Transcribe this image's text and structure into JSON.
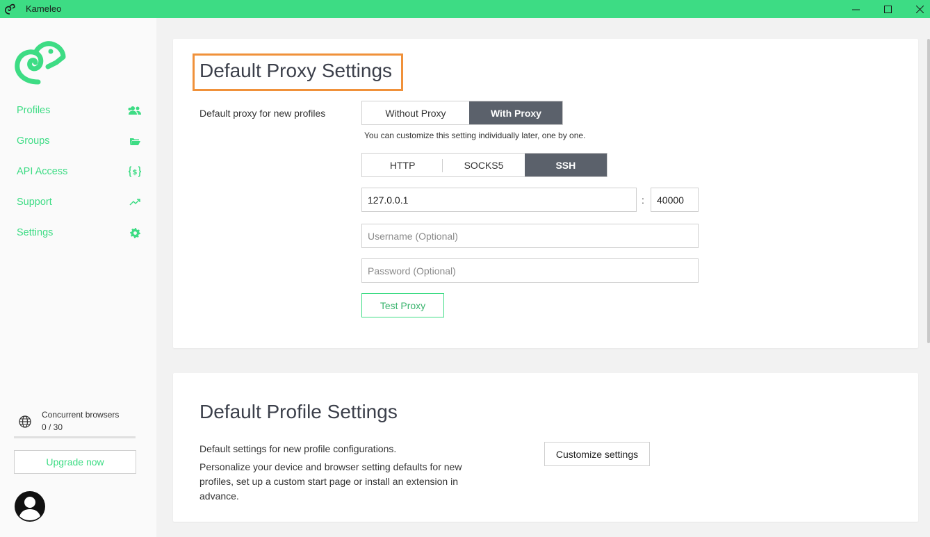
{
  "window": {
    "title": "Kameleo",
    "accent": "#3ddc84"
  },
  "sidebar": {
    "items": [
      {
        "label": "Profiles",
        "icon": "users-icon"
      },
      {
        "label": "Groups",
        "icon": "folder-open-icon"
      },
      {
        "label": "API Access",
        "icon": "code-braces-icon"
      },
      {
        "label": "Support",
        "icon": "trending-up-icon"
      },
      {
        "label": "Settings",
        "icon": "gear-icon"
      }
    ],
    "concurrent": {
      "label": "Concurrent browsers",
      "value": "0 / 30",
      "progress": 0
    },
    "upgrade_label": "Upgrade now"
  },
  "proxy_card": {
    "title": "Default Proxy Settings",
    "default_label": "Default proxy for new profiles",
    "mode_options": [
      "Without Proxy",
      "With Proxy"
    ],
    "mode_selected": "With Proxy",
    "hint": "You can customize this setting individually later, one by one.",
    "type_options": [
      "HTTP",
      "SOCKS5",
      "SSH"
    ],
    "type_selected": "SSH",
    "host": "127.0.0.1",
    "port_separator": ":",
    "port": "40000",
    "username_placeholder": "Username (Optional)",
    "password_placeholder": "Password (Optional)",
    "test_label": "Test Proxy"
  },
  "profile_card": {
    "title": "Default Profile Settings",
    "line1": "Default settings for new profile configurations.",
    "line2": "Personalize your device and browser setting defaults for new profiles, set up a custom start page or install an extension in advance.",
    "customize_label": "Customize settings"
  },
  "colors": {
    "highlight_border": "#f0913a",
    "active_segment": "#5b616b"
  }
}
